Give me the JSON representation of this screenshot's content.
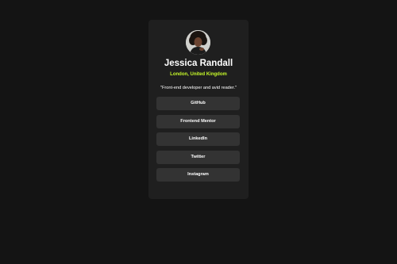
{
  "profile": {
    "name": "Jessica Randall",
    "location": "London, United Kingdom",
    "bio": "\"Front-end developer and avid reader.\""
  },
  "links": [
    {
      "label": "GitHub"
    },
    {
      "label": "Frontend Mentor"
    },
    {
      "label": "LinkedIn"
    },
    {
      "label": "Twitter"
    },
    {
      "label": "Instagram"
    }
  ],
  "colors": {
    "page_background": "#141414",
    "card_background": "#1f1f1f",
    "button_background": "#333333",
    "accent": "#c5f82a",
    "text": "#ffffff"
  }
}
